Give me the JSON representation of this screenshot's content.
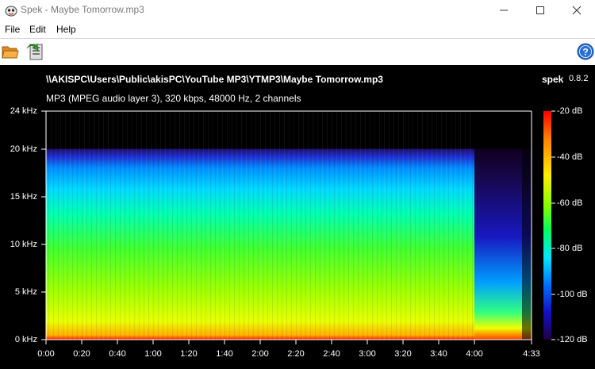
{
  "window": {
    "title": "Spek - Maybe Tomorrow.mp3"
  },
  "menu": {
    "file": "File",
    "edit": "Edit",
    "help": "Help"
  },
  "toolbar": {
    "open_icon": "folder-open-icon",
    "save_icon": "save-icon",
    "help_icon": "help-icon"
  },
  "analysis": {
    "file_path": "\\\\AKISPC\\Users\\Public\\akisPC\\YouTube MP3\\YTMP3\\Maybe Tomorrow.mp3",
    "app_name": "spek",
    "version": "0.8.2",
    "audio_info": "MP3 (MPEG audio layer 3), 320 kbps, 48000 Hz, 2 channels"
  },
  "freq_axis": [
    "24 kHz",
    "20 kHz",
    "15 kHz",
    "10 kHz",
    "5 kHz",
    "0 kHz"
  ],
  "time_axis": [
    "0:00",
    "0:20",
    "0:40",
    "1:00",
    "1:20",
    "1:40",
    "2:00",
    "2:20",
    "2:40",
    "3:00",
    "3:20",
    "3:40",
    "4:00",
    "4:33"
  ],
  "db_axis": [
    "-20 dB",
    "-40 dB",
    "-60 dB",
    "-80 dB",
    "-100 dB",
    "-120 dB"
  ],
  "colors": {
    "background": "#000000",
    "axis": "#ffffff"
  }
}
